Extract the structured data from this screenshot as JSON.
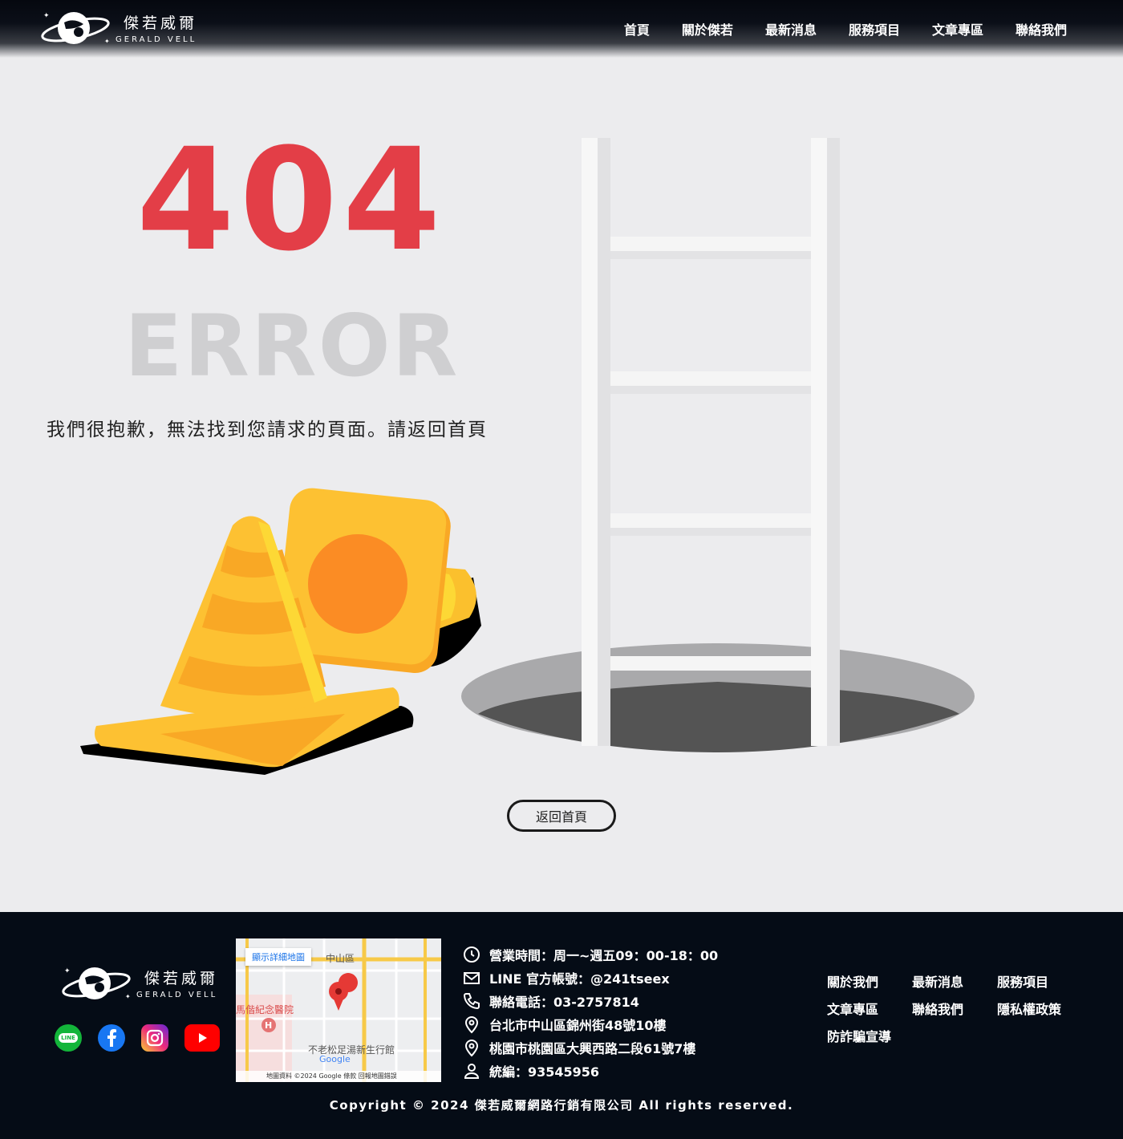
{
  "header": {
    "logo_cn": "傑若威爾",
    "logo_en": "GERALD VELL",
    "nav": [
      {
        "label": "首頁"
      },
      {
        "label": "關於傑若"
      },
      {
        "label": "最新消息"
      },
      {
        "label": "服務項目"
      },
      {
        "label": "文章專區"
      },
      {
        "label": "聯絡我們"
      }
    ]
  },
  "hero": {
    "code": "404",
    "error_word": "ERROR",
    "message": "我們很抱歉，無法找到您請求的頁面。請返回首頁",
    "home_button": "返回首頁",
    "accent_color": "#e33e47"
  },
  "footer": {
    "logo_cn": "傑若威爾",
    "logo_en": "GERALD VELL",
    "socials": [
      {
        "icon": "line-icon",
        "label": "LINE"
      },
      {
        "icon": "facebook-icon"
      },
      {
        "icon": "instagram-icon"
      },
      {
        "icon": "youtube-icon"
      }
    ],
    "map": {
      "button": "顯示詳細地圖",
      "labels": [
        "中山區",
        "馬偕紀念醫院",
        "不老松足湯新生行館",
        "Google"
      ],
      "attribution": "地圖資料 ©2024 Google  條款  回報地圖錯誤"
    },
    "contact": [
      {
        "icon": "clock-icon",
        "text": "營業時間：周一~週五09：00-18：00"
      },
      {
        "icon": "mail-icon",
        "text": "LINE 官方帳號：@241tseex"
      },
      {
        "icon": "phone-icon",
        "text": "聯絡電話：03-2757814"
      },
      {
        "icon": "location-icon",
        "text": "台北市中山區錦州街48號10樓"
      },
      {
        "icon": "location-icon",
        "text": "桃園市桃園區大興西路二段61號7樓"
      },
      {
        "icon": "person-icon",
        "text": "統編：93545956"
      }
    ],
    "links": [
      {
        "label": "關於我們"
      },
      {
        "label": "最新消息"
      },
      {
        "label": "服務項目"
      },
      {
        "label": "文章專區"
      },
      {
        "label": "聯絡我們"
      },
      {
        "label": "隱私權政策"
      },
      {
        "label": "防詐騙宣導"
      }
    ],
    "copyright": "Copyright © 2024 傑若威爾網路行銷有限公司 All rights reserved."
  }
}
